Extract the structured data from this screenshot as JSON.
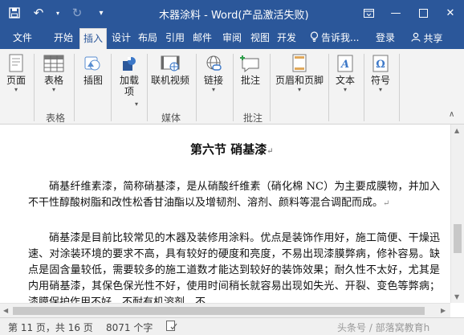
{
  "window": {
    "title": "木器涂料 - Word(产品激活失败)",
    "controls": [
      "restore-down",
      "minimize",
      "maximize",
      "close"
    ]
  },
  "quick_access": {
    "save": "save-icon",
    "undo": "undo-icon",
    "redo": "redo-icon",
    "customize": "customize-qat-icon"
  },
  "tabs": [
    "文件",
    "开始",
    "插入",
    "设计",
    "布局",
    "引用",
    "邮件",
    "审阅",
    "视图",
    "开发"
  ],
  "active_tab": "插入",
  "tell_me": "告诉我...",
  "login": "登录",
  "share": "共享",
  "ribbon": {
    "groups": [
      {
        "label": "",
        "buttons": [
          {
            "label": "页面",
            "dropdown": true,
            "icon": "pages-icon"
          }
        ]
      },
      {
        "label": "表格",
        "buttons": [
          {
            "label": "表格",
            "dropdown": true,
            "icon": "table-icon"
          }
        ]
      },
      {
        "label": "",
        "buttons": [
          {
            "label": "插图",
            "dropdown": false,
            "icon": "illustrations-icon"
          }
        ]
      },
      {
        "label": "",
        "buttons": [
          {
            "label": "加载\n项",
            "dropdown": true,
            "icon": "addins-icon"
          }
        ]
      },
      {
        "label": "媒体",
        "buttons": [
          {
            "label": "联机视频",
            "dropdown": false,
            "icon": "online-video-icon"
          }
        ]
      },
      {
        "label": "",
        "buttons": [
          {
            "label": "链接",
            "dropdown": true,
            "icon": "link-icon"
          }
        ]
      },
      {
        "label": "批注",
        "buttons": [
          {
            "label": "批注",
            "dropdown": false,
            "icon": "comment-icon"
          }
        ]
      },
      {
        "label": "",
        "buttons": [
          {
            "label": "页眉和页脚",
            "dropdown": true,
            "icon": "header-footer-icon"
          }
        ]
      },
      {
        "label": "",
        "buttons": [
          {
            "label": "文本",
            "dropdown": true,
            "icon": "text-icon"
          }
        ]
      },
      {
        "label": "",
        "buttons": [
          {
            "label": "符号",
            "dropdown": true,
            "icon": "symbol-icon"
          }
        ]
      }
    ],
    "collapse": "collapse-ribbon-icon"
  },
  "document": {
    "heading": "第六节  硝基漆",
    "paragraphs": [
      "硝基纤维素漆，简称硝基漆，是从硝酸纤维素（硝化棉 NC）为主要成膜物，并加入不干性醇酸树脂和改性松香甘油酯以及增韧剂、溶剂、颜料等混合调配而成。",
      "硝基漆是目前比较常见的木器及装修用涂料。优点是装饰作用好，施工简便、干燥迅速、对涂装环境的要求不高，具有较好的硬度和亮度，不易出现漆膜弊病，修补容易。缺点是固含量较低，需要较多的施工道数才能达到较好的装饰效果；耐久性不太好，尤其是内用硝基漆，其保色保光性不好，使用时间稍长就容易出现如失光、开裂、变色等弊病；漆膜保护作用不好，不耐有机溶剂、不"
    ],
    "paragraph_mark": "↵"
  },
  "status": {
    "page": "第 11 页，共 16 页",
    "words": "8071 个字",
    "proofing": "proofing-icon",
    "watermark": "头条号 / 部落窝教育h"
  }
}
